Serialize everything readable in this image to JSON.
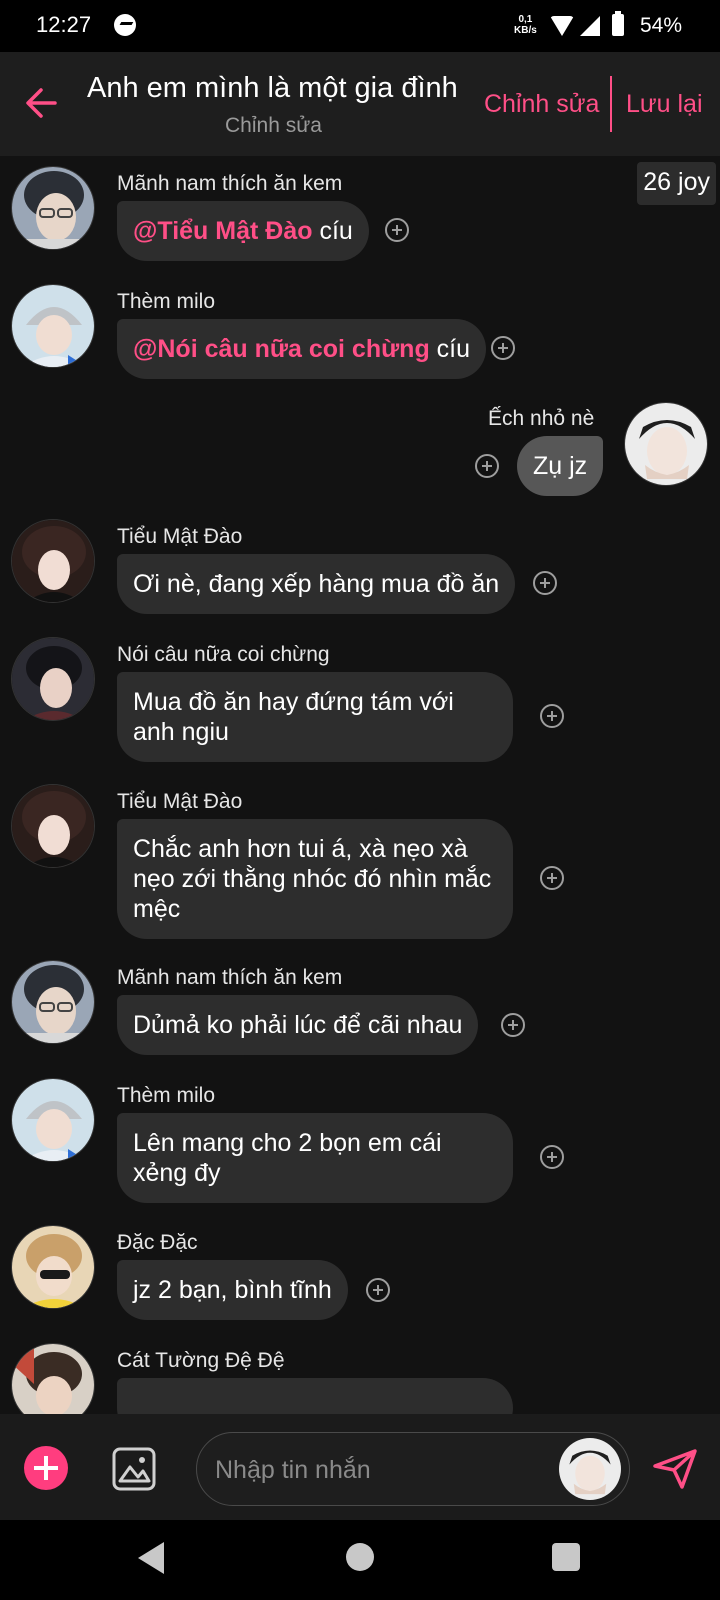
{
  "status": {
    "time": "12:27",
    "net_speed_value": "0,1",
    "net_speed_unit": "KB/s",
    "battery": "54%"
  },
  "header": {
    "title": "Anh em mình là một gia đình",
    "subtitle": "Chỉnh sửa",
    "edit_label": "Chỉnh sửa",
    "save_label": "Lưu lại"
  },
  "joy_badge": "26 joy",
  "messages": [
    {
      "sender": "Mãnh nam thích ăn kem",
      "mention": "@Tiểu Mật Đào",
      "text": " cíu"
    },
    {
      "sender": "Thèm milo",
      "mention": "@Nói câu nữa coi chừng",
      "text": " cíu"
    },
    {
      "sender": "Ếch nhỏ nè",
      "text": "Zụ jz"
    },
    {
      "sender": "Tiểu Mật Đào",
      "text": "Ơi nè, đang xếp hàng mua đồ ăn"
    },
    {
      "sender": "Nói câu nữa coi chừng",
      "text": "Mua đồ ăn hay đứng tám với anh ngiu"
    },
    {
      "sender": "Tiểu Mật Đào",
      "text": "Chắc anh hơn tui á, xà nẹo xà nẹo zới thằng nhóc đó nhìn mắc mệc"
    },
    {
      "sender": "Mãnh nam thích ăn kem",
      "text": "Dủmả ko phải lúc để cãi nhau"
    },
    {
      "sender": "Thèm milo",
      "text": "Lên mang cho 2 bọn em cái xẻng đy"
    },
    {
      "sender": "Đặc Đặc",
      "text": "jz 2 bạn, bình tĩnh"
    },
    {
      "sender": "Cát Tường Đệ Đệ",
      "text": ""
    }
  ],
  "composer": {
    "placeholder": "Nhập tin nhắn"
  },
  "colors": {
    "accent": "#ff4f87",
    "background": "#121212",
    "bubble_in": "#2d2d2d",
    "bubble_out": "#575757"
  }
}
